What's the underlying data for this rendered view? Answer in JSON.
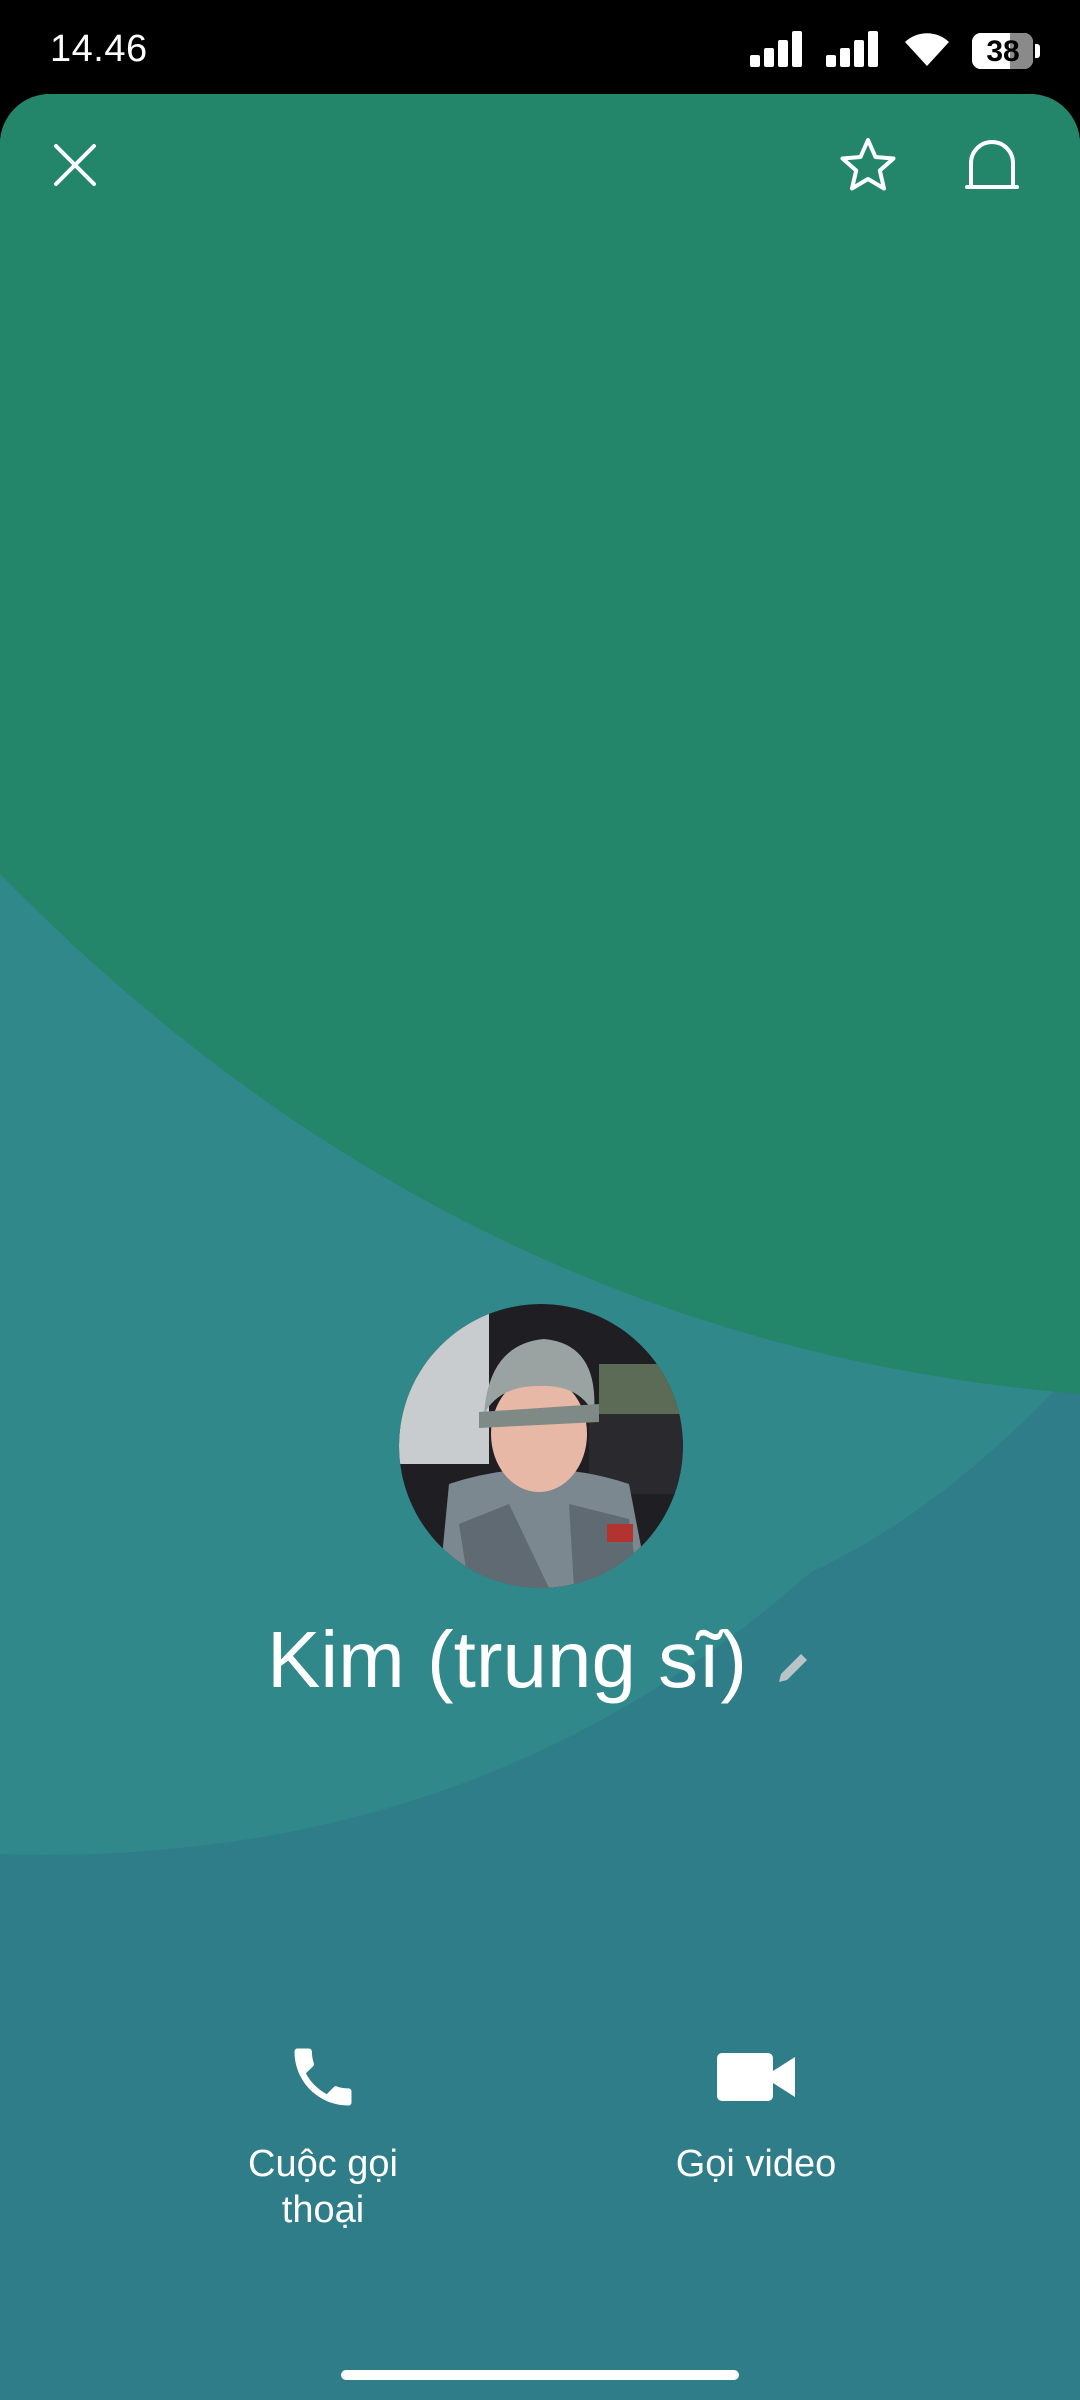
{
  "status_bar": {
    "time": "14.46",
    "battery": "38",
    "battery_level_pct": 62
  },
  "header": {
    "close_icon": "close-icon",
    "favorite_icon": "star-icon",
    "notification_icon": "bell-icon"
  },
  "contact": {
    "name": "Kim (trung sĩ)",
    "edit_icon": "pencil-icon"
  },
  "actions": [
    {
      "label": "Cuộc gọi\nthoại",
      "icon": "phone-icon"
    },
    {
      "label": "Gọi video",
      "icon": "video-camera-icon"
    }
  ],
  "colors": {
    "green": "#23866b",
    "teal": "#2e7d88",
    "teal_light": "#30888b"
  }
}
